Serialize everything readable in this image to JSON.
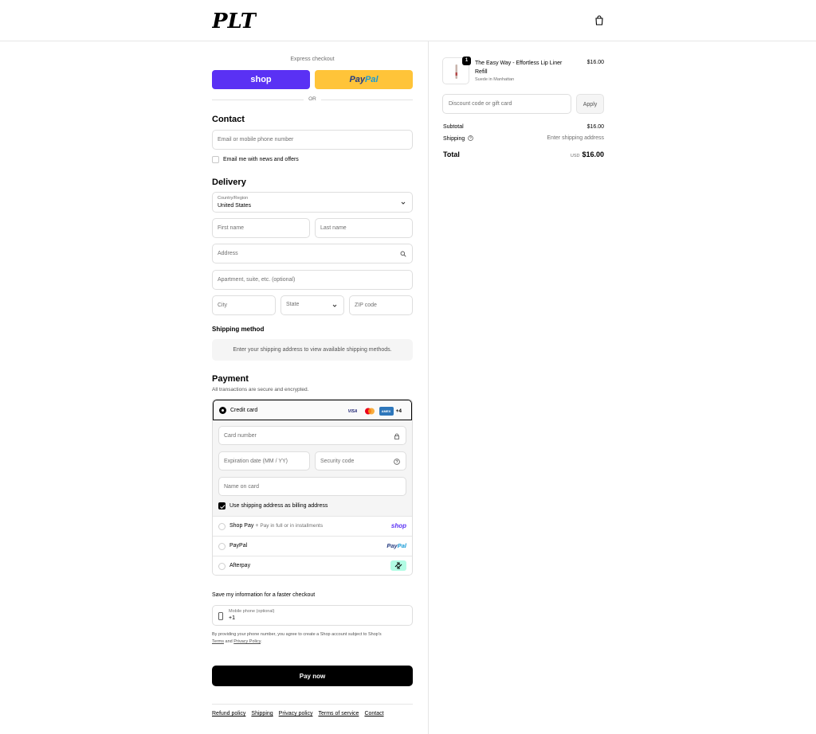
{
  "brand": {
    "logo_text": "PLT"
  },
  "express": {
    "label": "Express checkout",
    "shop_label": "shop",
    "paypal_part1": "Pay",
    "paypal_part2": "Pal",
    "or_label": "OR"
  },
  "contact": {
    "title": "Contact",
    "email_placeholder": "Email or mobile phone number",
    "newsletter_label": "Email me with news and offers"
  },
  "delivery": {
    "title": "Delivery",
    "country_label": "Country/Region",
    "country_value": "United States",
    "first_name_placeholder": "First name",
    "last_name_placeholder": "Last name",
    "address_placeholder": "Address",
    "apartment_placeholder": "Apartment, suite, etc. (optional)",
    "city_placeholder": "City",
    "state_placeholder": "State",
    "zip_placeholder": "ZIP code"
  },
  "shipping_method": {
    "title": "Shipping method",
    "message": "Enter your shipping address to view available shipping methods."
  },
  "payment": {
    "title": "Payment",
    "subtitle": "All transactions are secure and encrypted.",
    "credit_card_label": "Credit card",
    "card_more": "+4",
    "card_number_placeholder": "Card number",
    "expiry_placeholder": "Expiration date (MM / YY)",
    "security_placeholder": "Security code",
    "name_placeholder": "Name on card",
    "billing_label": "Use shipping address as billing address",
    "shoppay_label": "Shop Pay",
    "shoppay_sub": "Pay in full or in installments",
    "shoppay_logo": "shop",
    "paypal_label": "PayPal",
    "paypal_logo_1": "Pay",
    "paypal_logo_2": "Pal",
    "afterpay_label": "Afterpay"
  },
  "save_info": {
    "title": "Save my information for a faster checkout",
    "phone_label": "Mobile phone (optional)",
    "phone_value": "+1",
    "disclaimer_1": "By providing your phone number, you agree to create a Shop account subject to Shop's",
    "terms": "Terms",
    "and": "and",
    "privacy": "Privacy Policy",
    "period": "."
  },
  "pay_now_label": "Pay now",
  "footer": {
    "links": [
      "Refund policy",
      "Shipping",
      "Privacy policy",
      "Terms of service",
      "Contact"
    ]
  },
  "order": {
    "item_name": "The Easy Way - Effortless Lip Liner Refill",
    "item_variant": "Suede in Manhattan",
    "item_qty": "1",
    "item_price": "$16.00",
    "discount_placeholder": "Discount code or gift card",
    "apply_label": "Apply",
    "subtotal_label": "Subtotal",
    "subtotal_value": "$16.00",
    "shipping_label": "Shipping",
    "shipping_value": "Enter shipping address",
    "total_label": "Total",
    "currency": "USD",
    "total_value": "$16.00"
  },
  "colors": {
    "shop_purple": "#5a31f4",
    "paypal_yellow": "#ffc439",
    "afterpay_mint": "#b2fce4"
  }
}
